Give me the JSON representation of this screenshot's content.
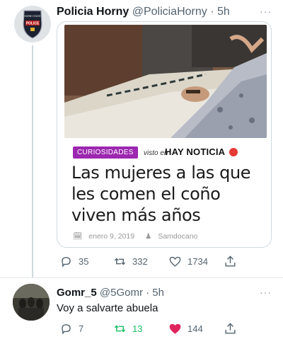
{
  "tweet": {
    "author_name": "Policia Horny",
    "author_handle": "@PoliciaHorny",
    "time": "· 5h",
    "more": "···",
    "badge": {
      "top_text": "HORNY STATE",
      "main_text": "POLICE"
    },
    "card": {
      "tag": "CURIOSIDADES",
      "visto_en": "visto en",
      "brand": "HAY NOTICIA",
      "headline": "Las mujeres a las que les comen el coño viven más años",
      "date": "enero 9, 2019",
      "author": "Samdocano"
    },
    "stats": {
      "replies": "35",
      "retweets": "332",
      "likes": "1734"
    }
  },
  "reply": {
    "author_name": "Gomr_5",
    "author_handle": "@5Gomr",
    "time": "· 5h",
    "more": "···",
    "text": "Voy a salvarte abuela",
    "stats": {
      "replies": "7",
      "retweets": "13",
      "likes": "144"
    }
  },
  "colors": {
    "retweet_active": "#17bf63",
    "like_active": "#e0245e",
    "tag_purple": "#9c27b0",
    "muted": "#536471"
  },
  "icons": [
    "reply-icon",
    "retweet-icon",
    "like-icon",
    "share-icon",
    "calendar-icon",
    "user-icon",
    "police-badge-icon"
  ]
}
